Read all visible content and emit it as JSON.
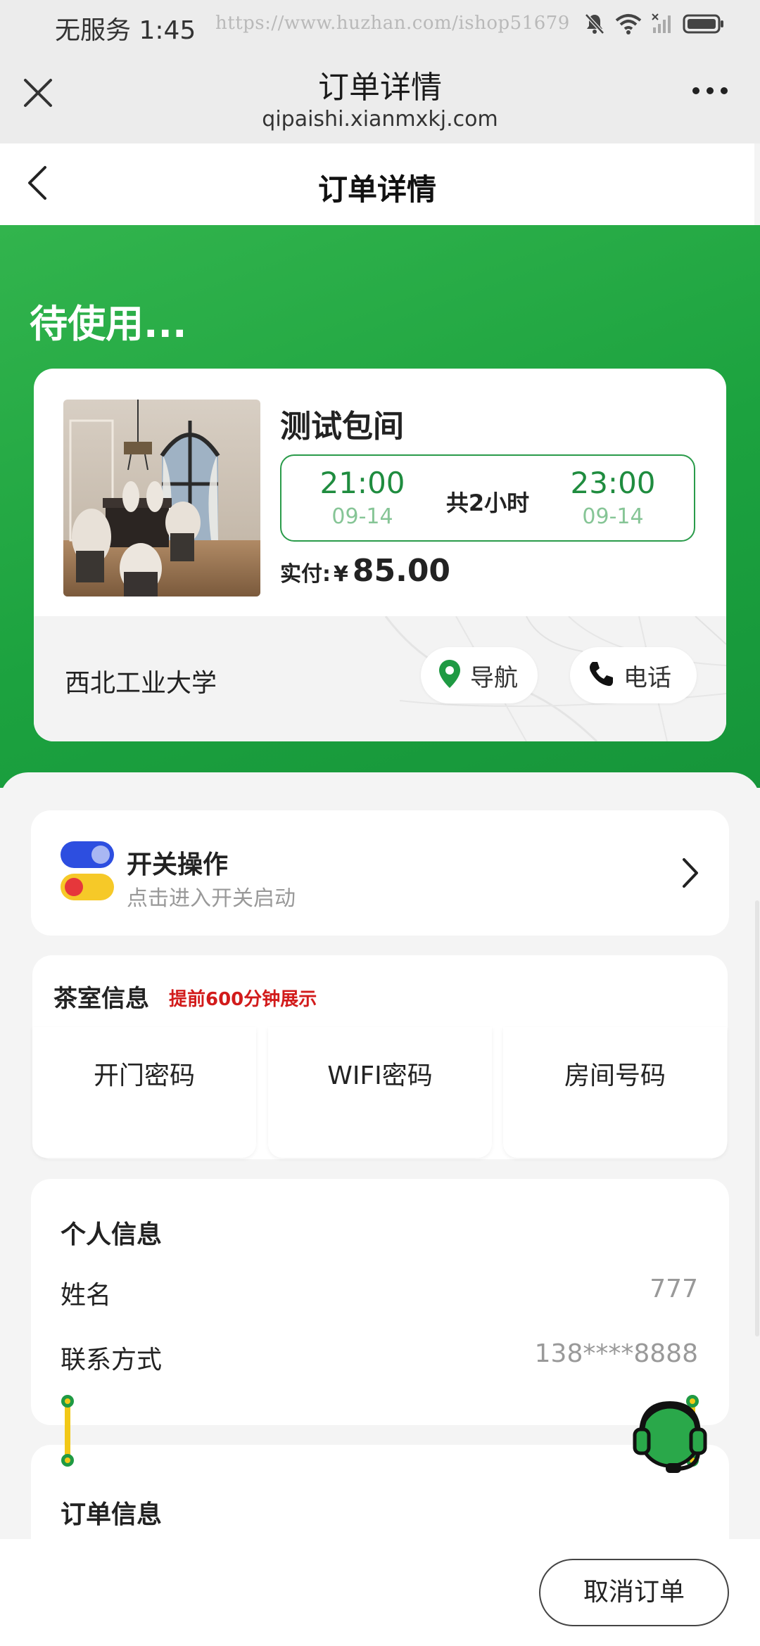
{
  "status_bar": {
    "carrier_time": "无服务 1:45",
    "watermark": "https://www.huzhan.com/ishop51679",
    "icons": [
      "bell-off-icon",
      "wifi-icon",
      "signal-off-icon",
      "battery-icon"
    ]
  },
  "browser": {
    "title": "订单详情",
    "url": "qipaishi.xianmxkj.com"
  },
  "page": {
    "title": "订单详情"
  },
  "order": {
    "status": "待使用...",
    "room_name": "测试包间",
    "start_time": "21:00",
    "start_date": "09-14",
    "end_time": "23:00",
    "end_date": "09-14",
    "duration": "共2小时",
    "paid_label": "实付:",
    "currency": "¥",
    "paid_amount": "85.00",
    "store_name": "西北工业大学",
    "nav_label": "导航",
    "phone_label": "电话"
  },
  "switch_panel": {
    "title": "开关操作",
    "subtitle": "点击进入开关启动"
  },
  "tea_room": {
    "title": "茶室信息",
    "note": "提前600分钟展示",
    "cells": [
      "开门密码",
      "WIFI密码",
      "房间号码"
    ]
  },
  "personal": {
    "title": "个人信息",
    "name_label": "姓名",
    "name_value": "777",
    "contact_label": "联系方式",
    "contact_value": "138****8888"
  },
  "order_info": {
    "title": "订单信息"
  },
  "footer": {
    "cancel_label": "取消订单"
  },
  "colors": {
    "brand_green": "#1ca23f",
    "accent_red": "#d21b1b",
    "toggle_blue": "#2d4ee0",
    "toggle_yellow": "#f6c928"
  }
}
